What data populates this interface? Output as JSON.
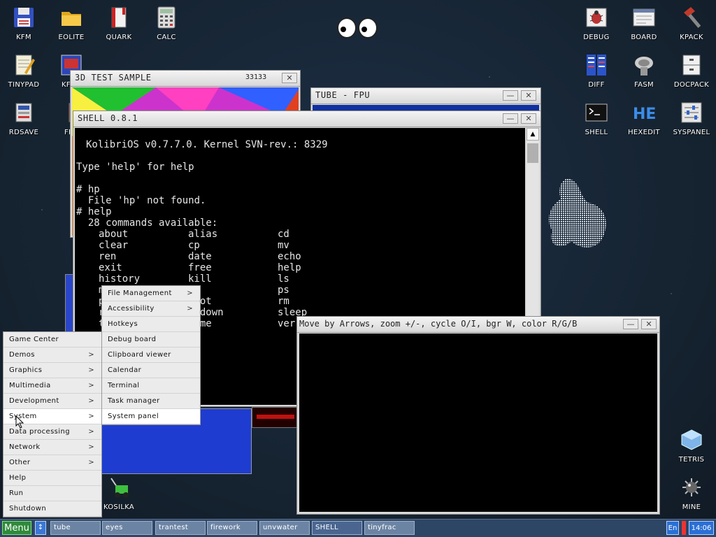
{
  "desktop_icons": [
    {
      "label": "KFM",
      "icon": "floppy-icon"
    },
    {
      "label": "EOLITE",
      "icon": "folder-icon"
    },
    {
      "label": "QUARK",
      "icon": "book-icon"
    },
    {
      "label": "CALC",
      "icon": "calculator-icon"
    },
    {
      "label": "TINYPAD",
      "icon": "notepad-icon"
    },
    {
      "label": "RDSAVE",
      "icon": "disk-save-icon"
    },
    {
      "label": "KOSILKA",
      "icon": "lawnmower-icon"
    },
    {
      "label": "DEBUG",
      "icon": "bug-icon"
    },
    {
      "label": "BOARD",
      "icon": "board-icon"
    },
    {
      "label": "KPACK",
      "icon": "hammer-icon"
    },
    {
      "label": "DIFF",
      "icon": "diff-icon"
    },
    {
      "label": "FASM",
      "icon": "fasm-icon"
    },
    {
      "label": "DOCPACK",
      "icon": "docpack-icon"
    },
    {
      "label": "SHELL",
      "icon": "terminal-icon"
    },
    {
      "label": "HEXEDIT",
      "icon": "hexedit-icon"
    },
    {
      "label": "SYSPANEL",
      "icon": "sliders-icon"
    },
    {
      "label": "TETRIS",
      "icon": "tetris-icon"
    },
    {
      "label": "MINE",
      "icon": "mine-icon"
    }
  ],
  "partial_icon_labels": [
    "KF",
    "FB2"
  ],
  "windows": {
    "test3d": {
      "title": "3D TEST SAMPLE",
      "corner_text": "33133"
    },
    "tube": {
      "title": "TUBE - FPU"
    },
    "shell": {
      "title": "SHELL 0.8.1",
      "lines": [
        "KolibriOS v0.7.7.0. Kernel SVN-rev.: 8329",
        "Type 'help' for help",
        "# hp",
        "  File 'hp' not found.",
        "# help",
        "  28 commands available:"
      ],
      "commands_col1": [
        "about",
        "clear",
        "ren",
        "exit",
        "history",
        "m",
        "p",
        "r",
        "t"
      ],
      "commands_col2": [
        "alias",
        "cp",
        "date",
        "free",
        "kill",
        "re",
        "boot",
        "utdown",
        "time"
      ],
      "commands_col3": [
        "cd",
        "mv",
        "echo",
        "help",
        "ls",
        "ps",
        "rm",
        "sleep",
        "ver"
      ]
    },
    "tinyfrac": {
      "title": "Move by Arrows, zoom +/-, cycle O/I, bgr W, color R/G/B"
    }
  },
  "main_menu": [
    {
      "label": "Game Center",
      "arrow": ""
    },
    {
      "label": "Demos",
      "arrow": ">"
    },
    {
      "label": "Graphics",
      "arrow": ">"
    },
    {
      "label": "Multimedia",
      "arrow": ">"
    },
    {
      "label": "Development",
      "arrow": ">"
    },
    {
      "label": "System",
      "arrow": ">"
    },
    {
      "label": "Data processing",
      "arrow": ">"
    },
    {
      "label": "Network",
      "arrow": ">"
    },
    {
      "label": "Other",
      "arrow": ">"
    },
    {
      "label": "Help",
      "arrow": ""
    },
    {
      "label": "Run",
      "arrow": ""
    },
    {
      "label": "Shutdown",
      "arrow": ""
    }
  ],
  "system_submenu": [
    {
      "label": "File Management",
      "arrow": ">"
    },
    {
      "label": "Accessibility",
      "arrow": ">"
    },
    {
      "label": "Hotkeys",
      "arrow": ""
    },
    {
      "label": "Debug board",
      "arrow": ""
    },
    {
      "label": "Clipboard viewer",
      "arrow": ""
    },
    {
      "label": "Calendar",
      "arrow": ""
    },
    {
      "label": "Terminal",
      "arrow": ""
    },
    {
      "label": "Task manager",
      "arrow": ""
    },
    {
      "label": "System panel",
      "arrow": ""
    }
  ],
  "taskbar": {
    "menu_label": "Menu",
    "switch_glyph": "↕",
    "tasks": [
      "tube",
      "eyes",
      "trantest",
      "firework",
      "unvwater",
      "SHELL",
      "tinyfrac"
    ],
    "lang": "En",
    "clock": "14:06"
  },
  "colors": {
    "menu_button": "#2f8a3a",
    "taskbar": "#2e4666",
    "task_button": "#6c84a4",
    "clock_bg": "#2a6fd6"
  }
}
